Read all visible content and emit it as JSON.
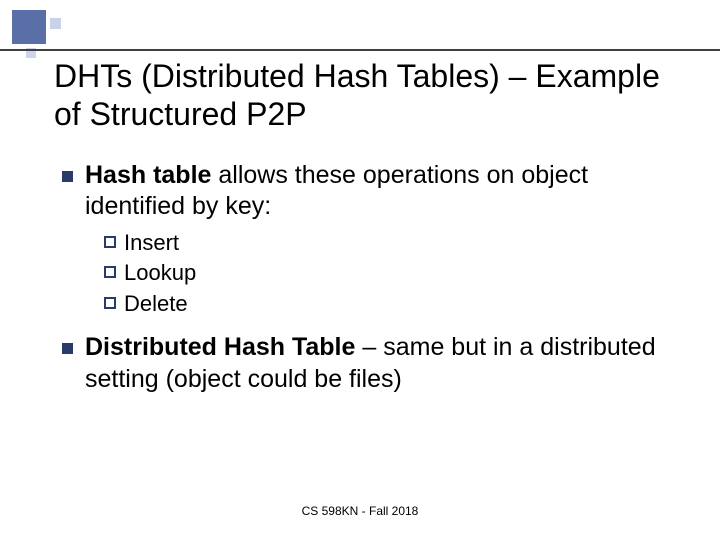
{
  "title": "DHTs (Distributed Hash Tables) – Example of Structured P2P",
  "bullets": [
    {
      "bold": "Hash table",
      "rest": " allows these operations on object identified by key:",
      "sub": [
        "Insert",
        "Lookup",
        "Delete"
      ]
    },
    {
      "bold": "Distributed Hash Table",
      "rest": " – same but in a distributed setting (object could be files)"
    }
  ],
  "footer": "CS 598KN - Fall 2018",
  "colors": {
    "bullet_fill": "#2a3a6a",
    "bullet_box_stroke": "#2a3a6a"
  }
}
